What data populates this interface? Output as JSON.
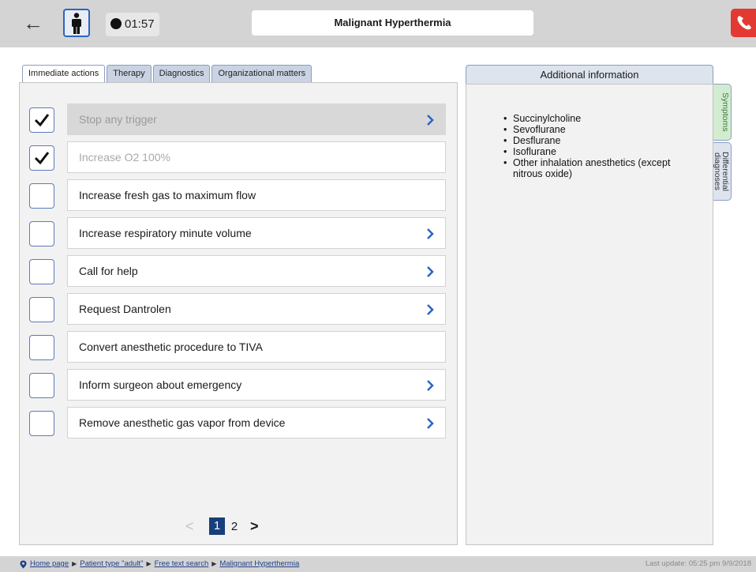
{
  "header": {
    "timer": "01:57",
    "title": "Malignant Hyperthermia"
  },
  "tabs": [
    {
      "label": "Immediate actions",
      "active": true
    },
    {
      "label": "Therapy",
      "active": false
    },
    {
      "label": "Diagnostics",
      "active": false
    },
    {
      "label": "Organizational matters",
      "active": false
    }
  ],
  "actions": [
    {
      "label": "Stop any trigger",
      "checked": true,
      "has_chevron": true
    },
    {
      "label": "Increase O2 100%",
      "checked": true,
      "has_chevron": false
    },
    {
      "label": "Increase fresh gas to maximum flow",
      "checked": false,
      "has_chevron": false
    },
    {
      "label": "Increase respiratory minute volume",
      "checked": false,
      "has_chevron": true
    },
    {
      "label": "Call for help",
      "checked": false,
      "has_chevron": true
    },
    {
      "label": "Request Dantrolen",
      "checked": false,
      "has_chevron": true
    },
    {
      "label": "Convert anesthetic procedure to TIVA",
      "checked": false,
      "has_chevron": false
    },
    {
      "label": "Inform surgeon about emergency",
      "checked": false,
      "has_chevron": true
    },
    {
      "label": "Remove anesthetic gas vapor from device",
      "checked": false,
      "has_chevron": true
    }
  ],
  "pagination": {
    "prev": "<",
    "current": "1",
    "page2": "2",
    "next": ">"
  },
  "info": {
    "title": "Additional information",
    "items": [
      "Succinylcholine",
      "Sevoflurane",
      "Desflurane",
      "Isoflurane",
      "Other inhalation anesthetics (except nitrous oxide)"
    ]
  },
  "side_tabs": {
    "symptoms": "Symptoms",
    "differential": "Differential diagnoses"
  },
  "footer": {
    "breadcrumbs": [
      "Home page",
      "Patient type \"adult\"",
      "Free text search",
      "Malignant Hyperthermia"
    ],
    "last_update": "Last update: 05:25 pm 9/9/2018"
  },
  "colors": {
    "accent_blue": "#2c64c4",
    "checkbox_border": "#5b7bbb",
    "phone_red": "#e23a32",
    "symptoms_green": "#d2ecd0",
    "page_current": "#173f7a"
  }
}
